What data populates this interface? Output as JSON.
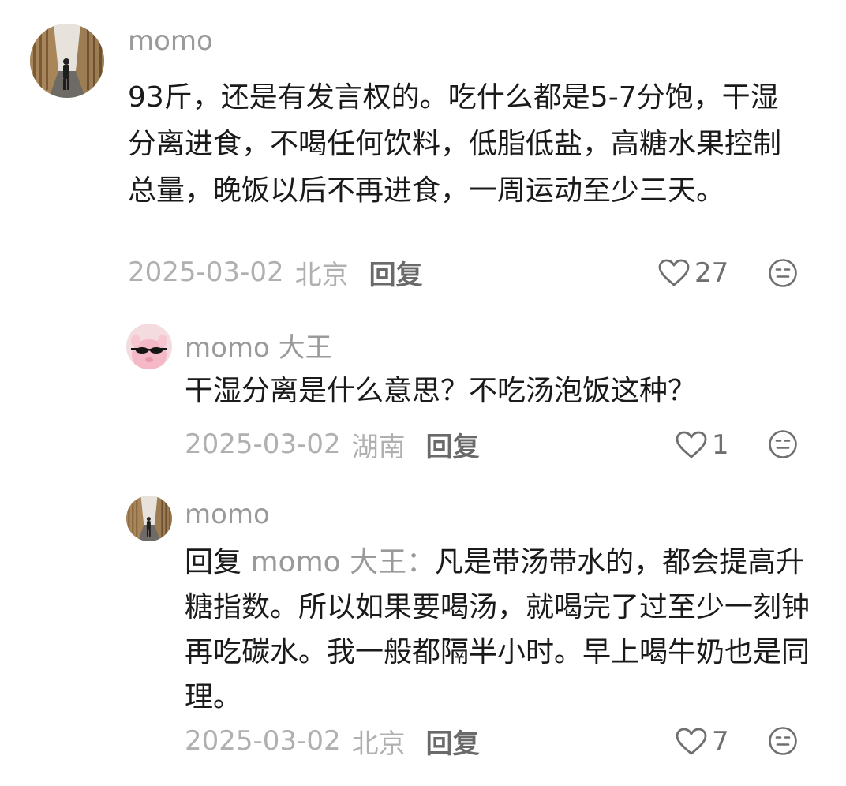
{
  "comments": [
    {
      "username": "momo",
      "text": "93斤，还是有发言权的。吃什么都是5-7分饱，干湿分离进食，不喝任何饮料，低脂低盐，高糖水果控制总量，晚饭以后不再进食，一周运动至少三天。",
      "date": "2025-03-02",
      "location": "北京",
      "reply_label": "回复",
      "likes": "27",
      "avatar": "person-walking-in-corridor"
    },
    {
      "username": "momo 大王",
      "text": "干湿分离是什么意思？不吃汤泡饭这种？",
      "date": "2025-03-02",
      "location": "湖南",
      "reply_label": "回复",
      "likes": "1",
      "avatar": "pink-plush-with-sunglasses"
    },
    {
      "username": "momo",
      "reply_prefix": "回复",
      "reply_to": "momo 大王：",
      "text": "凡是带汤带水的，都会提高升糖指数。所以如果要喝汤，就喝完了过至少一刻钟再吃碳水。我一般都隔半小时。早上喝牛奶也是同理。",
      "date": "2025-03-02",
      "location": "北京",
      "reply_label": "回复",
      "likes": "7",
      "avatar": "person-walking-in-corridor"
    }
  ],
  "icons": {
    "like": "heart-outline-icon",
    "reaction": "neutral-face-icon"
  },
  "colors": {
    "username": "#9a9a9a",
    "text": "#1a1a1a",
    "meta": "#b0b0b0",
    "reply_button": "#6a6a6a"
  }
}
